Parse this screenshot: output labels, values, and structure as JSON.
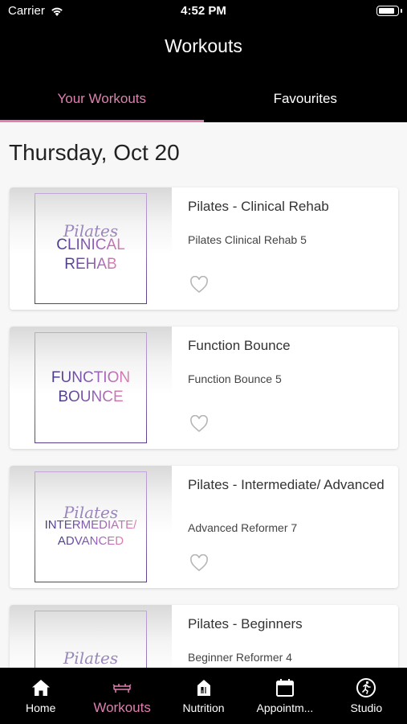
{
  "status_bar": {
    "carrier": "Carrier",
    "time": "4:52 PM",
    "battery_level": 0.9
  },
  "header": {
    "title": "Workouts"
  },
  "tabs": [
    {
      "label": "Your Workouts",
      "active": true
    },
    {
      "label": "Favourites",
      "active": false
    }
  ],
  "date_heading": "Thursday, Oct 20",
  "workouts": [
    {
      "thumb_script": "Pilates",
      "thumb_lines": [
        "CLINICAL",
        "REHAB"
      ],
      "title": "Pilates - Clinical Rehab",
      "subtitle": "Pilates Clinical Rehab 5",
      "favourite": false
    },
    {
      "thumb_script": "",
      "thumb_lines": [
        "FUNCTION",
        "BOUNCE"
      ],
      "title": "Function Bounce",
      "subtitle": "Function Bounce 5",
      "favourite": false
    },
    {
      "thumb_script": "Pilates",
      "thumb_lines": [
        "INTERMEDIATE/",
        "ADVANCED"
      ],
      "title": "Pilates - Intermediate/ Advanced",
      "subtitle": "Advanced Reformer 7",
      "favourite": false
    },
    {
      "thumb_script": "Pilates",
      "thumb_lines": [],
      "title": "Pilates - Beginners",
      "subtitle": "Beginner Reformer 4",
      "favourite": false
    }
  ],
  "tabbar": [
    {
      "label": "Home",
      "icon": "home-icon",
      "active": false
    },
    {
      "label": "Workouts",
      "icon": "reformer-bed-icon",
      "active": true
    },
    {
      "label": "Nutrition",
      "icon": "nutrition-icon",
      "active": false
    },
    {
      "label": "Appointm...",
      "icon": "calendar-icon",
      "active": false
    },
    {
      "label": "Studio",
      "icon": "studio-runner-icon",
      "active": false
    }
  ],
  "colors": {
    "accent": "#e07fb0",
    "bar_background": "#000000",
    "thumb_text_start": "#4a3a8c",
    "thumb_text_end": "#e07fb0"
  }
}
